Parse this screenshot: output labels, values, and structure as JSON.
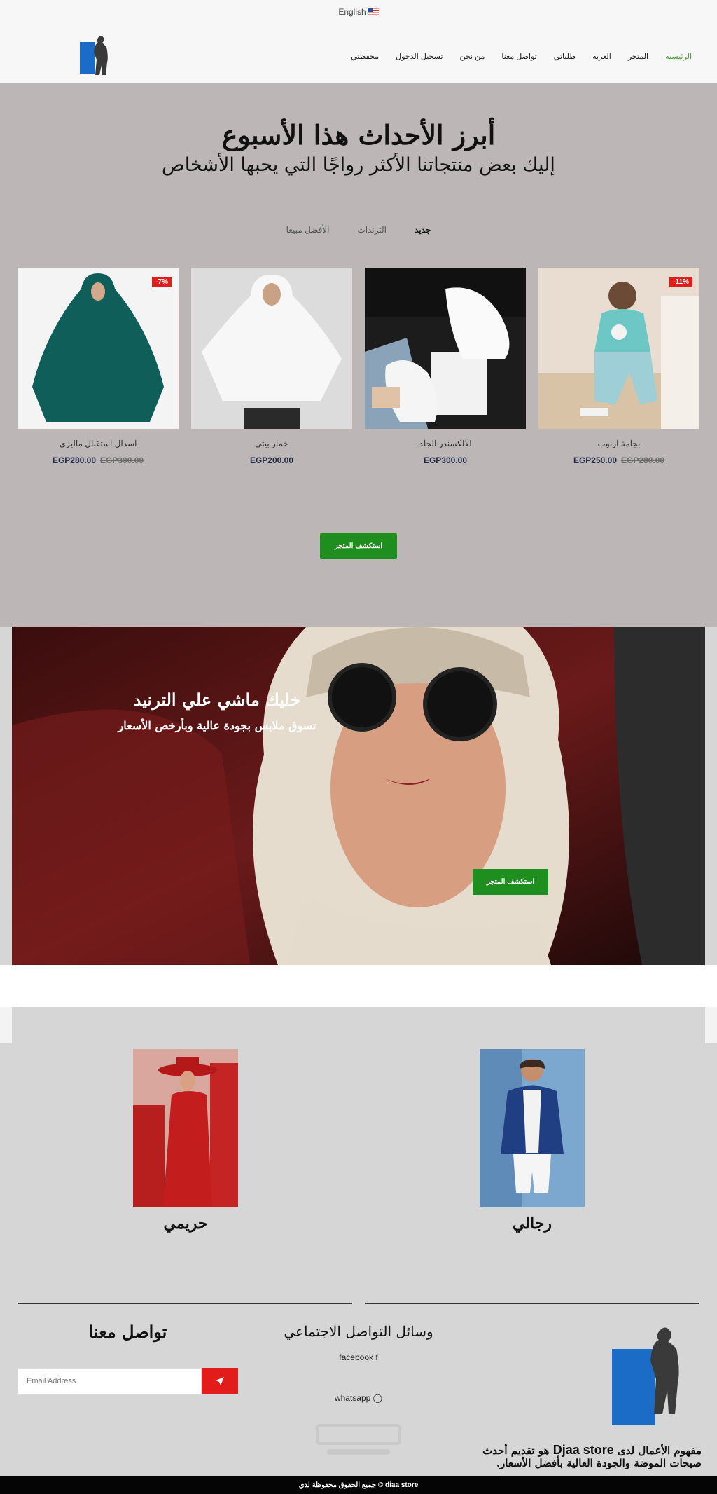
{
  "header": {
    "language": "English",
    "nav": [
      {
        "label": "الرئيسية",
        "active": true
      },
      {
        "label": "المتجر",
        "active": false
      },
      {
        "label": "العربة",
        "active": false
      },
      {
        "label": "طلباتي",
        "active": false
      },
      {
        "label": "تواصل معنا",
        "active": false
      },
      {
        "label": "من نحن",
        "active": false
      },
      {
        "label": "تسجيل الدخول",
        "active": false
      },
      {
        "label": "محفظتي",
        "active": false
      }
    ]
  },
  "highlights": {
    "title": "أبرز الأحداث هذا الأسبوع",
    "subtitle": "إليك بعض منتجاتنا الأكثر رواجًا التي يحبها الأشخاص",
    "tabs": [
      {
        "label": "جديد",
        "active": true
      },
      {
        "label": "الترندات",
        "active": false
      },
      {
        "label": "الأفضل مبيعا",
        "active": false
      }
    ],
    "products": [
      {
        "name": "بجامة ارنوب",
        "price": "EGP250.00",
        "old_price": "EGP280.00",
        "badge": "-11%"
      },
      {
        "name": "الالكسندر الجلد",
        "price": "EGP300.00",
        "old_price": "",
        "badge": ""
      },
      {
        "name": "خمار بيتى",
        "price": "EGP200.00",
        "old_price": "",
        "badge": ""
      },
      {
        "name": "اسدال استقبال ماليزى",
        "price": "EGP280.00",
        "old_price": "EGP300.00",
        "badge": "-7%"
      }
    ],
    "explore_label": "استكشف المتجر"
  },
  "banner": {
    "title": "خليك ماشي علي الترنيد",
    "subtitle": "تسوق ملابس بجودة عالية وبأرخص الأسعار",
    "explore_label": "استكشف المتجر"
  },
  "categories": [
    {
      "label": "رجالي"
    },
    {
      "label": "حريمي"
    }
  ],
  "footer": {
    "contact_title": "تواصل معنا",
    "email_placeholder": "Email Address",
    "social_title": "وسائل التواصل الاجتماعي",
    "facebook_label": "facebook",
    "whatsapp_label": "whatsapp",
    "about_prefix": "مفهوم الأعمال لدى",
    "about_brand": "Djaa store",
    "about_suffix": "هو تقديم أحدث صيحات الموضة والجودة العالية بأفضل الأسعار.",
    "copyright": "جميع الحقوق محفوظة لدي © diaa store"
  },
  "colors": {
    "accent_green": "#1e8f1e",
    "sale_red": "#e21b1b",
    "highlight_bg": "#bdb6b6",
    "logo_blue": "#1a6cc7"
  }
}
